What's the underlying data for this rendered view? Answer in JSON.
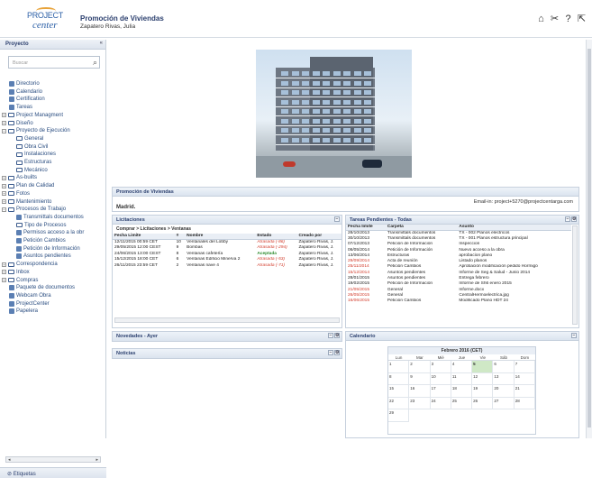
{
  "header": {
    "logo_line1": "PROJECT",
    "logo_line2": "center",
    "title": "Promoción de Viviendas",
    "user": "Zapatero Rivas, Julia",
    "icons": [
      "home-icon",
      "tools-icon",
      "help-icon",
      "logout-icon"
    ]
  },
  "sidebar": {
    "title": "Proyecto",
    "collapse_glyph": "«",
    "search_placeholder": "Buscar",
    "items": [
      {
        "label": "Directorio",
        "icon": "directory-icon"
      },
      {
        "label": "Calendario",
        "icon": "calendar-icon"
      },
      {
        "label": "Certification",
        "icon": "certificate-icon"
      },
      {
        "label": "Tareas",
        "icon": "task-icon"
      },
      {
        "label": "Project Managment",
        "icon": "folder-icon"
      },
      {
        "label": "Diseño",
        "icon": "folder-icon"
      },
      {
        "label": "Proyecto de Ejecución",
        "icon": "folder-icon"
      },
      {
        "label": "General",
        "icon": "folder-icon"
      },
      {
        "label": "Obra Civil",
        "icon": "folder-icon"
      },
      {
        "label": "Instalaciones",
        "icon": "folder-icon"
      },
      {
        "label": "Estructuras",
        "icon": "folder-icon"
      },
      {
        "label": "Mecánico",
        "icon": "folder-icon"
      },
      {
        "label": "As-builts",
        "icon": "folder-icon"
      },
      {
        "label": "Plan de Calidad",
        "icon": "folder-icon"
      },
      {
        "label": "Fotos",
        "icon": "folder-icon"
      },
      {
        "label": "Mantenimiento",
        "icon": "folder-icon"
      },
      {
        "label": "Procesos de Trabajo",
        "icon": "folder-icon"
      },
      {
        "label": "Transmittals documentos",
        "icon": "document-icon"
      },
      {
        "label": "Tipo de Procesos",
        "icon": "folder-icon"
      },
      {
        "label": "Permisos acceso a la obr",
        "icon": "document-icon"
      },
      {
        "label": "Petición Cambios",
        "icon": "document-icon"
      },
      {
        "label": "Petición de Información",
        "icon": "document-icon"
      },
      {
        "label": "Asuntos pendientes",
        "icon": "document-icon"
      },
      {
        "label": "Correspondencia",
        "icon": "folder-icon"
      },
      {
        "label": "Inbox",
        "icon": "folder-icon"
      },
      {
        "label": "Compras",
        "icon": "folder-icon"
      },
      {
        "label": "Paquete de documentos",
        "icon": "package-icon"
      },
      {
        "label": "Webcam Obra",
        "icon": "webcam-icon"
      },
      {
        "label": "ProjectCenter",
        "icon": "globe-icon"
      },
      {
        "label": "Papelera",
        "icon": "trash-icon"
      }
    ],
    "footer": "Etiquetas"
  },
  "project_panel": {
    "title": "Promoción de Viviendas",
    "email": "Email-in: project+5270@projectcentarga.com",
    "location": "Madrid."
  },
  "licitaciones": {
    "title": "Licitaciones",
    "breadcrumb": "Comprar > Licitaciones > Ventanas",
    "columns": [
      "Fecha Limite",
      "#",
      "Nombre",
      "Estado",
      "Creado por"
    ],
    "rows": [
      {
        "fecha": "12/11/2015 00:59 CET",
        "num": "10",
        "nombre": "Ventanales del Lobby",
        "estado": "Atrasada (-86)",
        "estado_type": "red",
        "creado": "Zapatero Rivas, J."
      },
      {
        "fecha": "29/05/2015 12:00 CEST",
        "num": "9",
        "nombre": "Bombas",
        "estado": "Atrasada (-294)",
        "estado_type": "red",
        "creado": "Zapatero Rivas, J."
      },
      {
        "fecha": "24/06/2015 13:00 CEST",
        "num": "8",
        "nombre": "Ventanas cafetería",
        "estado": "Aceptada",
        "estado_type": "green",
        "creado": "Zapatero Rivas, J."
      },
      {
        "fecha": "15/12/2015 18:00 CET",
        "num": "6",
        "nombre": "Ventanas Edificio Minerva 2",
        "estado": "Atrasada (-53)",
        "estado_type": "red",
        "creado": "Zapatero Rivas, J."
      },
      {
        "fecha": "26/11/2015 23:59 CET",
        "num": "2",
        "nombre": "Ventanas nave 4",
        "estado": "Atrasada (-71)",
        "estado_type": "red",
        "creado": "Zapatero Rivas, J."
      }
    ]
  },
  "tareas": {
    "title": "Tareas Pendientes - Todas",
    "columns": [
      "Fecha límite",
      "Carpeta",
      "Asunto"
    ],
    "rows": [
      {
        "fecha": "28/10/2013",
        "red": false,
        "carpeta": "Transmittals documentos",
        "asunto": "TX - 002 Planos electricos"
      },
      {
        "fecha": "30/10/2013",
        "red": false,
        "carpeta": "Transmittals documentos",
        "asunto": "TX - 001 Planos estructura principal"
      },
      {
        "fecha": "07/12/2013",
        "red": false,
        "carpeta": "Petición de Información",
        "asunto": "Inspeccion"
      },
      {
        "fecha": "06/05/2014",
        "red": false,
        "carpeta": "Petición de Información",
        "asunto": "Nuevo acceso a la obra"
      },
      {
        "fecha": "13/06/2014",
        "red": false,
        "carpeta": "Estructuras",
        "asunto": "aprobacion plano"
      },
      {
        "fecha": "29/09/2014",
        "red": true,
        "carpeta": "Acta de reunión",
        "asunto": "Listado planos"
      },
      {
        "fecha": "25/11/2014",
        "red": true,
        "carpeta": "Petición Cambios",
        "asunto": "Aprobación modificación pedido Hormigó"
      },
      {
        "fecha": "15/12/2014",
        "red": true,
        "carpeta": "Asuntos pendientes",
        "asunto": "Informe de Seg & Salud - Junio 2014"
      },
      {
        "fecha": "28/01/2015",
        "red": false,
        "carpeta": "Asuntos pendientes",
        "asunto": "Entrega febrero"
      },
      {
        "fecha": "19/02/2015",
        "red": false,
        "carpeta": "Petición de Información",
        "asunto": "Informe de Sh6 enero 2015"
      },
      {
        "fecha": "21/05/2015",
        "red": true,
        "carpeta": "General",
        "asunto": "Informe.docx"
      },
      {
        "fecha": "26/05/2015",
        "red": true,
        "carpeta": "General",
        "asunto": "CentralHermoelectrica.jpg"
      },
      {
        "fecha": "16/06/2015",
        "red": true,
        "carpeta": "Petición Cambios",
        "asunto": "Modificado Plano HDT 24"
      }
    ]
  },
  "novedades": {
    "title": "Novedades - Ayer"
  },
  "noticias": {
    "title": "Noticias"
  },
  "calendario": {
    "title": "Calendario",
    "month": "Febrero 2016 (CET)",
    "days_of_week": [
      "Lun",
      "Mar",
      "Mié",
      "Jue",
      "Vie",
      "Sáb",
      "Dom"
    ],
    "days": [
      "1",
      "2",
      "3",
      "4",
      "5",
      "6",
      "7",
      "8",
      "9",
      "10",
      "11",
      "12",
      "13",
      "14",
      "15",
      "16",
      "17",
      "18",
      "19",
      "20",
      "21",
      "22",
      "23",
      "24",
      "25",
      "26",
      "27",
      "28",
      "29"
    ],
    "today": "5",
    "accent_color": "#cfe8c6"
  },
  "colors": {
    "header_text": "#2b3f6e",
    "overdue": "#d23a2a",
    "accepted": "#2b8a2b"
  }
}
